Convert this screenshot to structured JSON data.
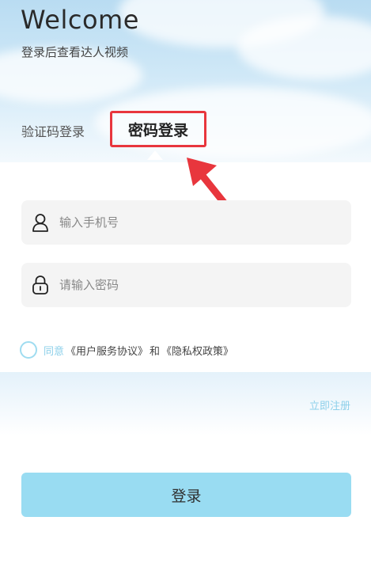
{
  "header": {
    "title": "Welcome",
    "subtitle": "登录后查看达人视频"
  },
  "tabs": {
    "sms_label": "验证码登录",
    "password_label": "密码登录",
    "active": "password"
  },
  "form": {
    "phone_placeholder": "输入手机号",
    "password_placeholder": "请输入密码"
  },
  "agreement": {
    "agree_word": "同意",
    "user_agreement": "《用户服务协议》",
    "and_word": "和",
    "privacy_policy": "《隐私权政策》",
    "checked": false
  },
  "register_label": "立即注册",
  "login_label": "登录",
  "colors": {
    "accent": "#99dcf2",
    "link": "#8dd0ea",
    "highlight": "#e8363d"
  }
}
